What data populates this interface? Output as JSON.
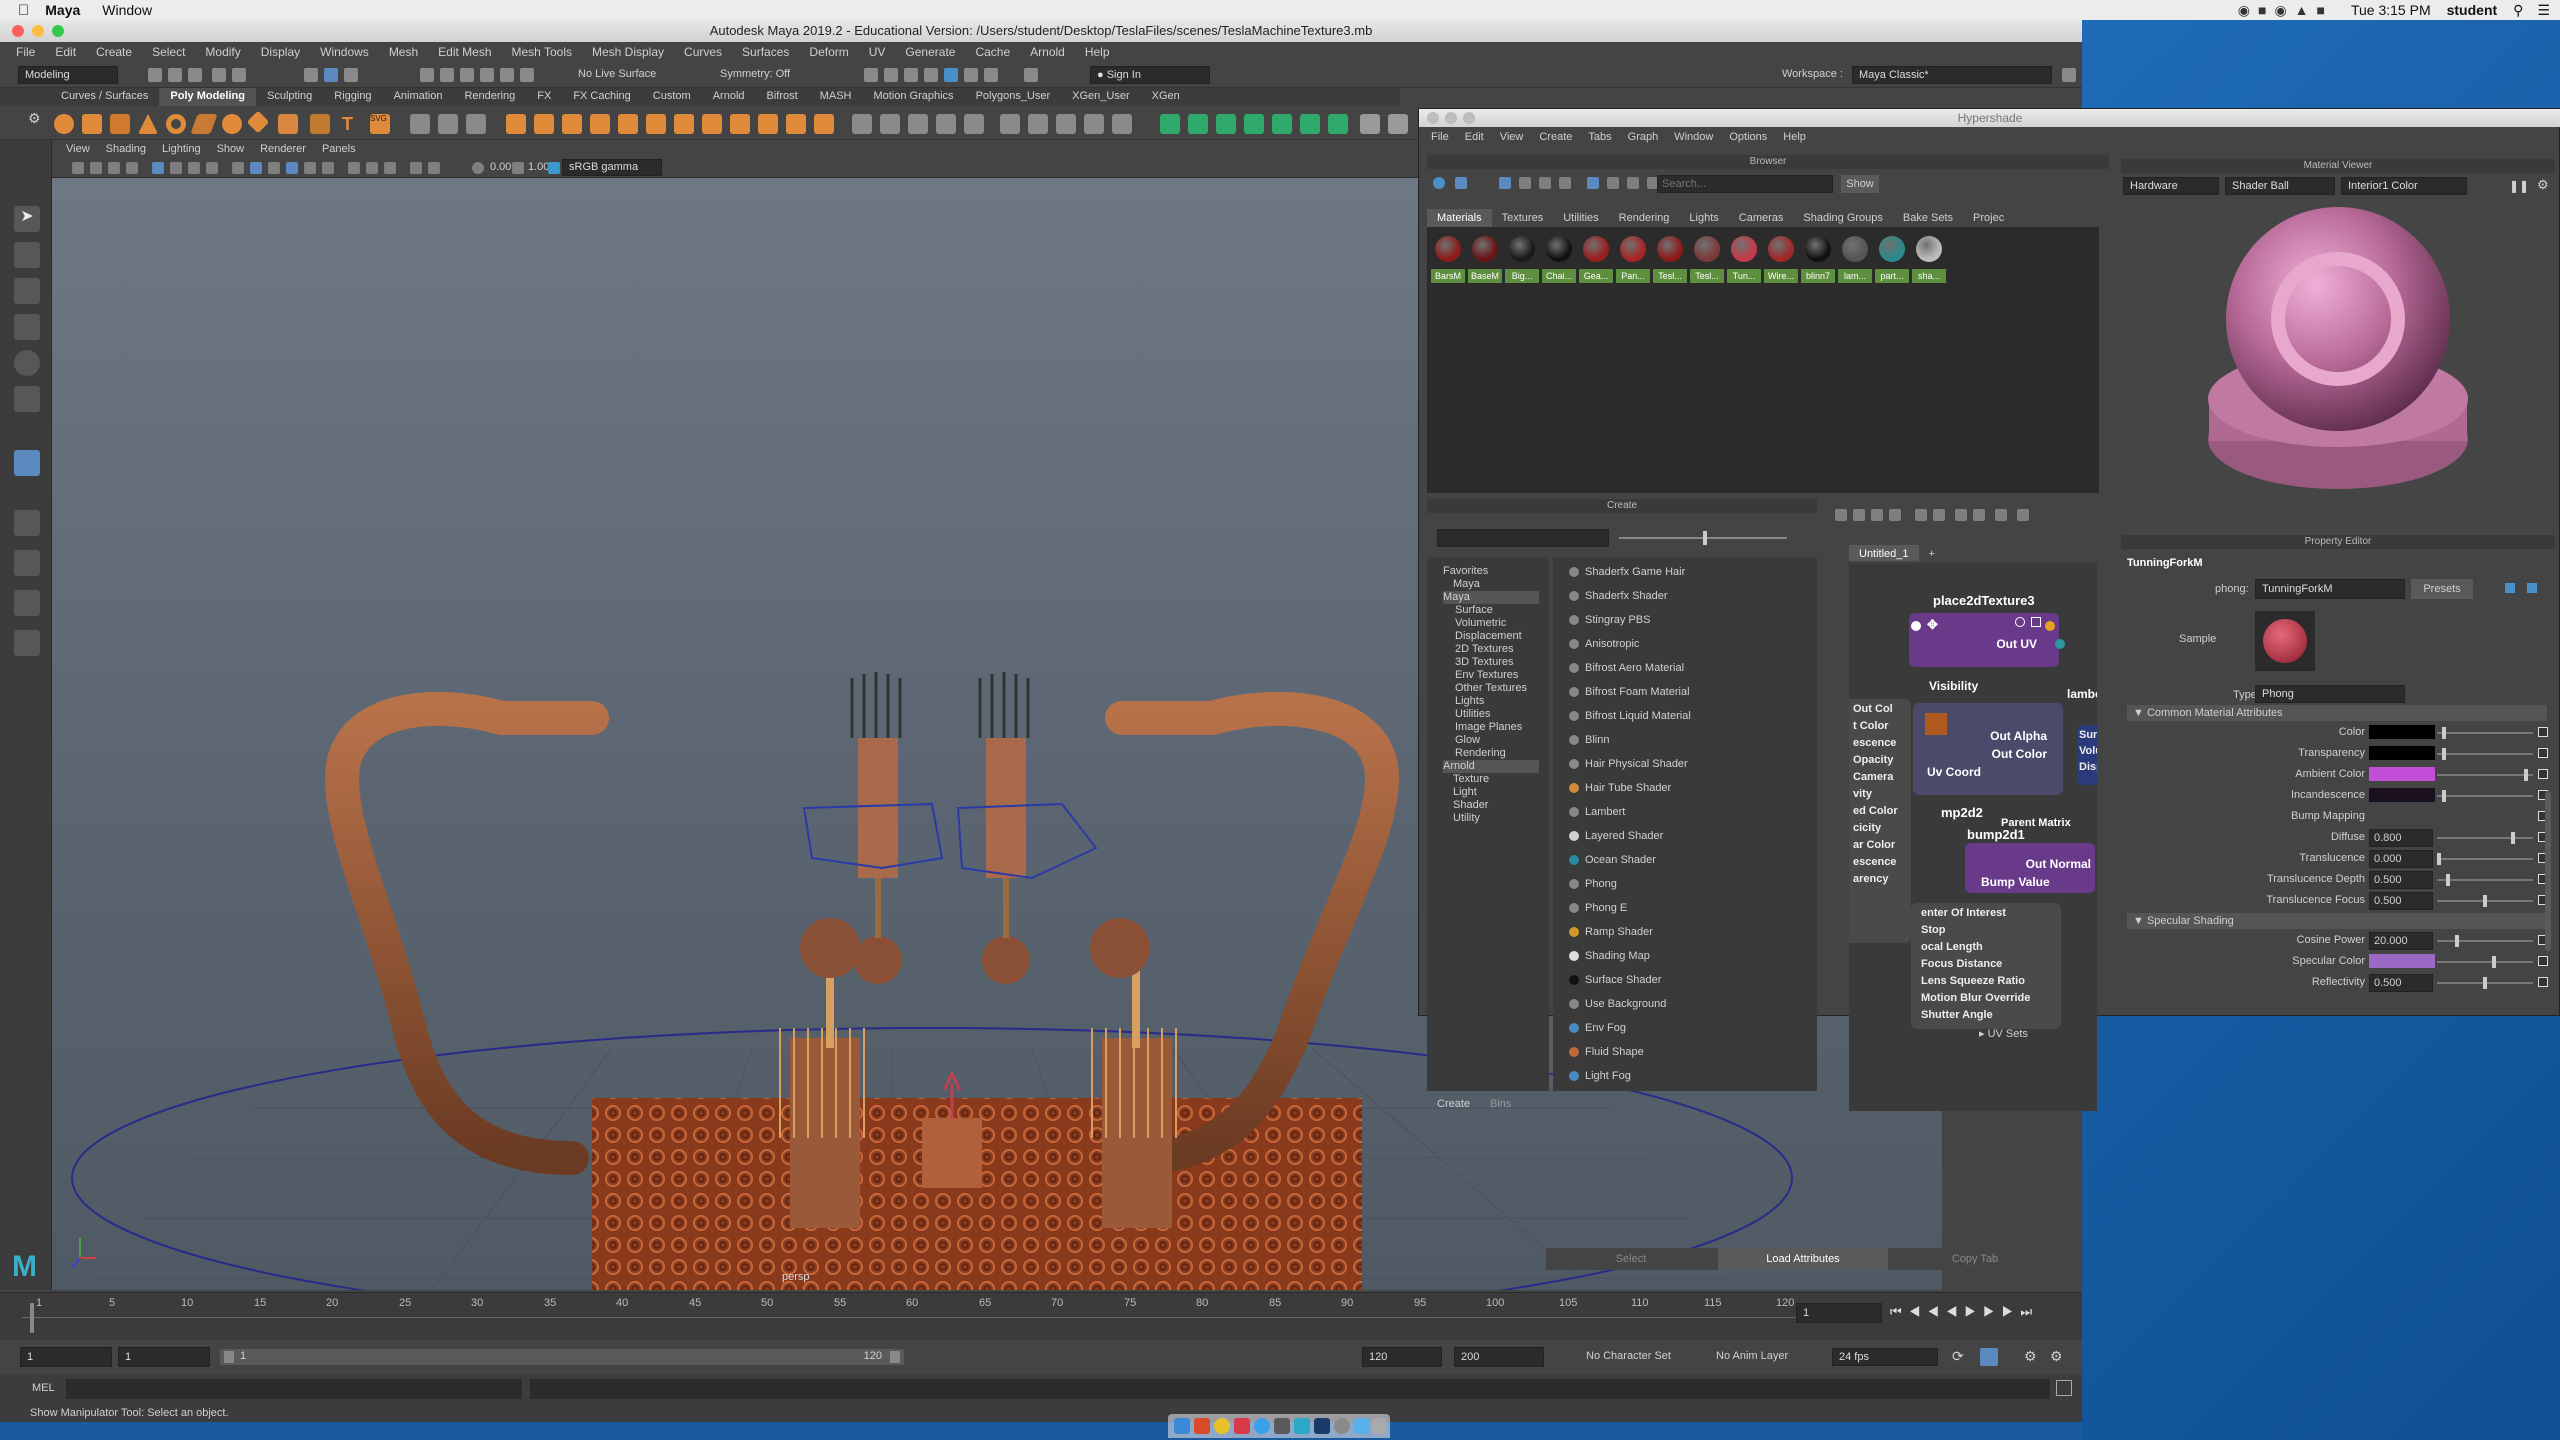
{
  "macbar": {
    "app": "Maya",
    "menu1": "Window",
    "clock": "Tue 3:15 PM",
    "user": "student"
  },
  "maya": {
    "title": "Autodesk Maya 2019.2 - Educational Version: /Users/student/Desktop/TeslaFiles/scenes/TeslaMachineTexture3.mb",
    "menus": [
      "File",
      "Edit",
      "Create",
      "Select",
      "Modify",
      "Display",
      "Windows",
      "Mesh",
      "Edit Mesh",
      "Mesh Tools",
      "Mesh Display",
      "Curves",
      "Surfaces",
      "Deform",
      "UV",
      "Generate",
      "Cache",
      "Arnold",
      "Help"
    ],
    "status": {
      "menuset": "Modeling",
      "live": "No Live Surface",
      "symmetry": "Symmetry: Off",
      "signin": "Sign In",
      "workspace_label": "Workspace :",
      "workspace": "Maya Classic*"
    },
    "shelf_tabs": [
      "Curves / Surfaces",
      "Poly Modeling",
      "Sculpting",
      "Rigging",
      "Animation",
      "Rendering",
      "FX",
      "FX Caching",
      "Custom",
      "Arnold",
      "Bifrost",
      "MASH",
      "Motion Graphics",
      "Polygons_User",
      "XGen_User",
      "XGen"
    ],
    "active_shelf": "Poly Modeling",
    "viewport_menus": [
      "View",
      "Shading",
      "Lighting",
      "Show",
      "Renderer",
      "Panels"
    ],
    "vp_val1": "0.00",
    "vp_val2": "1.00",
    "colorspace": "sRGB gamma",
    "camera_label": "persp",
    "timeline_ticks": [
      "1",
      "5",
      "10",
      "15",
      "20",
      "25",
      "30",
      "35",
      "40",
      "45",
      "50",
      "55",
      "60",
      "65",
      "70",
      "75",
      "80",
      "85",
      "90",
      "95",
      "100",
      "105",
      "110",
      "115",
      "120"
    ],
    "current_frame": "1",
    "range": {
      "start": "1",
      "start2": "1",
      "slider_start": "1",
      "slider_end": "120",
      "end": "120",
      "end2": "200",
      "character": "No Character Set",
      "anim_layer": "No Anim Layer",
      "fps": "24 fps"
    },
    "cmd_label": "MEL",
    "help_text": "Show Manipulator Tool: Select an object."
  },
  "hypershade": {
    "title": "Hypershade",
    "menus": [
      "File",
      "Edit",
      "View",
      "Create",
      "Tabs",
      "Graph",
      "Window",
      "Options",
      "Help"
    ],
    "browser_title": "Browser",
    "search_placeholder": "Search...",
    "show_button": "Show",
    "browser_tabs": [
      "Materials",
      "Textures",
      "Utilities",
      "Rendering",
      "Lights",
      "Cameras",
      "Shading Groups",
      "Bake Sets",
      "Projec"
    ],
    "materials": [
      {
        "label": "BarsM",
        "color": "#8a1c1c"
      },
      {
        "label": "BaseM",
        "color": "#6a1414"
      },
      {
        "label": "Big...",
        "color": "#1a1a1a"
      },
      {
        "label": "Chai...",
        "color": "#111111"
      },
      {
        "label": "Gea...",
        "color": "#9a1e1e"
      },
      {
        "label": "Pan...",
        "color": "#a82424"
      },
      {
        "label": "Tesl...",
        "color": "#8c1a1a"
      },
      {
        "label": "Tesl...",
        "color": "#7a3a3a"
      },
      {
        "label": "Tun...",
        "color": "#c43a4a"
      },
      {
        "label": "Wire...",
        "color": "#a02828"
      },
      {
        "label": "blinn7",
        "color": "#111111"
      },
      {
        "label": "lam...",
        "color": "#555555"
      },
      {
        "label": "part...",
        "color": "#2a8a8a"
      },
      {
        "label": "sha...",
        "color": "#bbbbbb"
      }
    ],
    "create_title": "Create",
    "tree": [
      "Favorites",
      "Maya",
      "Maya",
      "Surface",
      "Volumetric",
      "Displacement",
      "2D Textures",
      "3D Textures",
      "Env Textures",
      "Other Textures",
      "Lights",
      "Utilities",
      "Image Planes",
      "Glow",
      "Rendering",
      "Arnold",
      "Texture",
      "Light",
      "Shader",
      "Utility"
    ],
    "shaders": [
      {
        "name": "Shaderfx Game Hair",
        "color": "#888888"
      },
      {
        "name": "Shaderfx Shader",
        "color": "#888888"
      },
      {
        "name": "Stingray PBS",
        "color": "#888888"
      },
      {
        "name": "Anisotropic",
        "color": "#888888"
      },
      {
        "name": "Bifrost Aero Material",
        "color": "#888888"
      },
      {
        "name": "Bifrost Foam Material",
        "color": "#888888"
      },
      {
        "name": "Bifrost Liquid Material",
        "color": "#888888"
      },
      {
        "name": "Blinn",
        "color": "#888888"
      },
      {
        "name": "Hair Physical Shader",
        "color": "#888888"
      },
      {
        "name": "Hair Tube Shader",
        "color": "#d08a3a"
      },
      {
        "name": "Lambert",
        "color": "#888888"
      },
      {
        "name": "Layered Shader",
        "color": "#d0d0d0"
      },
      {
        "name": "Ocean Shader",
        "color": "#2a8aa0"
      },
      {
        "name": "Phong",
        "color": "#888888"
      },
      {
        "name": "Phong E",
        "color": "#888888"
      },
      {
        "name": "Ramp Shader",
        "color": "#d09a2a"
      },
      {
        "name": "Shading Map",
        "color": "#dddddd"
      },
      {
        "name": "Surface Shader",
        "color": "#111111"
      },
      {
        "name": "Use Background",
        "color": "#888888"
      },
      {
        "name": "Env Fog",
        "color": "#4a8ac0"
      },
      {
        "name": "Fluid Shape",
        "color": "#c06a3a"
      },
      {
        "name": "Light Fog",
        "color": "#4a8ac0"
      }
    ],
    "bottom_tabs": [
      "Create",
      "Bins"
    ],
    "graph_tab": "Untitled_1",
    "graph_add": "+",
    "node_place2d": "place2dTexture3",
    "node_place2d_out": "Out UV",
    "attrs_col1": [
      "Visibility"
    ],
    "node_file_out": [
      "Out Alpha",
      "Out Color"
    ],
    "uv_coord": "Uv Coord",
    "node_bump_title": "bump2d1",
    "node_bump_out": [
      "Out Normal",
      "Bump Value"
    ],
    "overlap_text": "mp2d2",
    "lambert_text": "lambe",
    "partial_left": [
      "Out Col",
      "t Color",
      "escence",
      "Opacity",
      "Camera",
      "vity",
      "ed Color",
      "cicity",
      "ar Color",
      "escence",
      "arency"
    ],
    "partial_right": [
      "Surf",
      "Volu",
      "Disp"
    ],
    "camera_attrs": [
      "enter Of Interest",
      "Stop",
      "ocal Length",
      "Focus Distance",
      "Lens Squeeze Ratio",
      "Motion Blur Override",
      "Shutter Angle"
    ],
    "parent_matrix": "Parent Matrix",
    "viewer_title": "Material Viewer",
    "viewer_dd": [
      "Hardware",
      "Shader Ball",
      "Interior1 Color"
    ],
    "pe_title": "Property Editor",
    "pe_node": "TunningForkM",
    "pe_type_label": "phong:",
    "pe_name": "TunningForkM",
    "presets": "Presets",
    "sample_label": "Sample",
    "type_label": "Type",
    "type_value": "Phong",
    "section1": "Common Material Attributes",
    "attrs": [
      {
        "label": "Color",
        "value": "",
        "swatch": "#000000",
        "knob": 0.05
      },
      {
        "label": "Transparency",
        "value": "",
        "swatch": "#000000",
        "knob": 0.05
      },
      {
        "label": "Ambient Color",
        "value": "",
        "swatch": "#c24ed8",
        "knob": 0.95
      },
      {
        "label": "Incandescence",
        "value": "",
        "swatch": "#1a1020",
        "knob": 0.05
      },
      {
        "label": "Bump Mapping",
        "value": "",
        "swatch": "",
        "knob": -1
      },
      {
        "label": "Diffuse",
        "value": "0.800",
        "swatch": "",
        "knob": 0.8
      },
      {
        "label": "Translucence",
        "value": "0.000",
        "swatch": "",
        "knob": 0.0
      },
      {
        "label": "Translucence Depth",
        "value": "0.500",
        "swatch": "",
        "knob": 0.1
      },
      {
        "label": "Translucence Focus",
        "value": "0.500",
        "swatch": "",
        "knob": 0.5
      }
    ],
    "section2": "Specular Shading",
    "attrs2": [
      {
        "label": "Cosine Power",
        "value": "20.000",
        "swatch": "",
        "knob": 0.2
      },
      {
        "label": "Specular Color",
        "value": "",
        "swatch": "#9b68c4",
        "knob": 0.6
      },
      {
        "label": "Reflectivity",
        "value": "0.500",
        "swatch": "",
        "knob": 0.5
      }
    ],
    "uv_sets": "UV Sets",
    "load_tabs": [
      "Select",
      "Load Attributes",
      "Copy Tab"
    ]
  },
  "accent": "#e08a3c"
}
